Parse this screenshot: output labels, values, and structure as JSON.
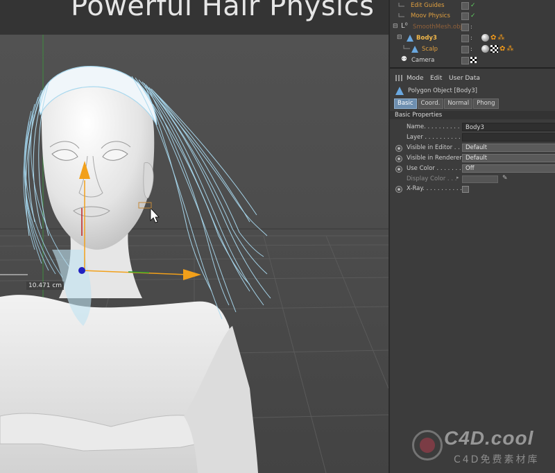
{
  "viewport": {
    "title": "Powerful Hair Physics",
    "dimension_label": "10.471 cm"
  },
  "object_manager": {
    "items": [
      {
        "label": "Edit Guides",
        "color": "#e0a040",
        "icon": "guides-icon"
      },
      {
        "label": "Moov Physics",
        "color": "#e0a040",
        "icon": "physics-icon"
      },
      {
        "label": "SmoothMesh.obj",
        "color": "#d8823a",
        "icon": "null-object-icon"
      },
      {
        "label": "Body3",
        "color": "#f2b84a",
        "icon": "polygon-object-icon"
      },
      {
        "label": "Scalp",
        "color": "#f2b84a",
        "icon": "polygon-object-icon"
      },
      {
        "label": "Camera",
        "color": "#d8d8d8",
        "icon": "camera-icon"
      }
    ]
  },
  "attribute_manager": {
    "menu": [
      "Mode",
      "Edit",
      "User Data"
    ],
    "object_title": "Polygon Object [Body3]",
    "tabs": [
      "Basic",
      "Coord.",
      "Normal",
      "Phong"
    ],
    "active_tab": "Basic",
    "section": "Basic Properties",
    "properties": [
      {
        "label": "Name. . . . . . . . . . . . .",
        "value": "Body3",
        "kind": "text"
      },
      {
        "label": "Layer . . . . . . . . . . . .",
        "value": "",
        "kind": "text"
      },
      {
        "label": "Visible in Editor . . .",
        "value": "Default",
        "kind": "select"
      },
      {
        "label": "Visible in Renderer",
        "value": "Default",
        "kind": "select"
      },
      {
        "label": "Use Color . . . . . . . . .",
        "value": "Off",
        "kind": "select"
      },
      {
        "label": "Display Color . . .",
        "value": "",
        "kind": "color"
      },
      {
        "label": "X-Ray. . . . . . . . . . . .",
        "value": "",
        "kind": "checkbox"
      }
    ]
  },
  "watermark": {
    "brand": "C4D.cool",
    "subtitle": "C4D免费素材库"
  },
  "colors": {
    "accent_orange": "#f29a1a",
    "hair_blue": "#a8d8ee",
    "tab_active": "#6e8fb0"
  }
}
